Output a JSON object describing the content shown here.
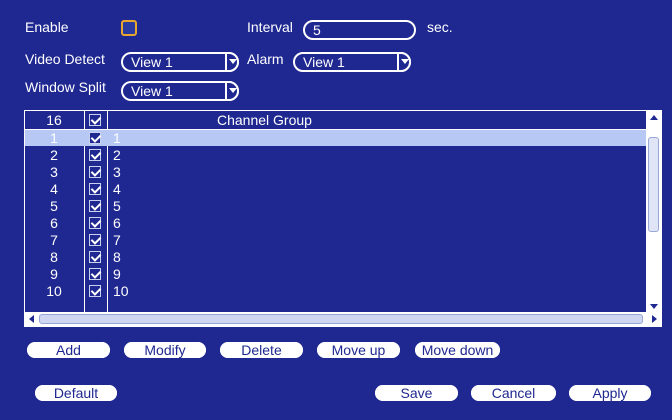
{
  "form": {
    "enable_label": "Enable",
    "interval_label": "Interval",
    "interval_value": "5",
    "interval_unit": "sec.",
    "video_detect_label": "Video Detect",
    "video_detect_value": "View 1",
    "alarm_label": "Alarm",
    "alarm_value": "View 1",
    "window_split_label": "Window Split",
    "window_split_value": "View 1"
  },
  "table": {
    "header_count": "16",
    "header_name": "Channel Group",
    "rows": [
      {
        "num": "1",
        "name": "1"
      },
      {
        "num": "2",
        "name": "2"
      },
      {
        "num": "3",
        "name": "3"
      },
      {
        "num": "4",
        "name": "4"
      },
      {
        "num": "5",
        "name": "5"
      },
      {
        "num": "6",
        "name": "6"
      },
      {
        "num": "7",
        "name": "7"
      },
      {
        "num": "8",
        "name": "8"
      },
      {
        "num": "9",
        "name": "9"
      },
      {
        "num": "10",
        "name": "10"
      }
    ]
  },
  "buttons": {
    "add": "Add",
    "modify": "Modify",
    "delete": "Delete",
    "move_up": "Move up",
    "move_down": "Move down",
    "default": "Default",
    "save": "Save",
    "cancel": "Cancel",
    "apply": "Apply"
  },
  "colors": {
    "background": "#1f2890",
    "selected_row": "#b8c8f4",
    "enable_checkbox_border": "#e8a830"
  }
}
